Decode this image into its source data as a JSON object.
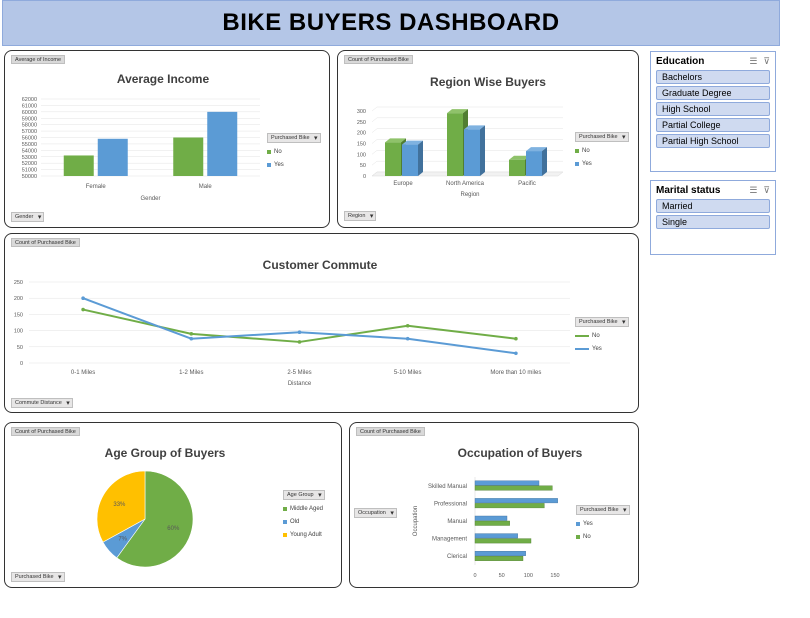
{
  "title": "BIKE BUYERS DASHBOARD",
  "colors": {
    "no": "#70ad47",
    "yes": "#5b9bd5",
    "young": "#ffc000",
    "header": "#b4c6e7"
  },
  "income": {
    "tag": "Average of Income",
    "title": "Average Income",
    "filter": "Gender",
    "legend_title": "Purchased Bike",
    "xlabel": "Gender",
    "chart_data": {
      "type": "bar",
      "categories": [
        "Female",
        "Male"
      ],
      "yticks": [
        "62000",
        "61000",
        "60000",
        "59000",
        "58000",
        "57000",
        "56000",
        "55000",
        "54000",
        "53000",
        "52000",
        "51000",
        "50000"
      ],
      "ylim": [
        50000,
        62000
      ],
      "series": [
        {
          "name": "No",
          "values": [
            53200,
            56000
          ]
        },
        {
          "name": "Yes",
          "values": [
            55800,
            60000
          ]
        }
      ]
    }
  },
  "region": {
    "tag": "Count of Purchased Bike",
    "title": "Region Wise Buyers",
    "filter": "Region",
    "legend_title": "Purchased Bike",
    "xlabel": "Region",
    "chart_data": {
      "type": "bar",
      "categories": [
        "Europe",
        "North America",
        "Pacific"
      ],
      "yticks": [
        "300",
        "250",
        "200",
        "150",
        "100",
        "50",
        "0"
      ],
      "ylim": [
        0,
        300
      ],
      "series": [
        {
          "name": "No",
          "values": [
            155,
            290,
            75
          ]
        },
        {
          "name": "Yes",
          "values": [
            145,
            215,
            115
          ]
        }
      ]
    }
  },
  "commute": {
    "tag": "Count of Purchased Bike",
    "title": "Customer Commute",
    "filter": "Commute Distance",
    "legend_title": "Purchased Bike",
    "xlabel": "Distance",
    "chart_data": {
      "type": "line",
      "categories": [
        "0-1 Miles",
        "1-2 Miles",
        "2-5 Miles",
        "5-10 Miles",
        "More than 10 miles"
      ],
      "yticks": [
        "250",
        "200",
        "150",
        "100",
        "50",
        "0"
      ],
      "ylim": [
        0,
        250
      ],
      "series": [
        {
          "name": "No",
          "values": [
            165,
            90,
            65,
            115,
            75
          ]
        },
        {
          "name": "Yes",
          "values": [
            200,
            75,
            95,
            75,
            30
          ]
        }
      ]
    }
  },
  "age": {
    "tag": "Count of Purchased Bike",
    "title": "Age Group of Buyers",
    "filter": "Purchased Bike",
    "legend_title": "Age Group",
    "chart_data": {
      "type": "pie",
      "labels": [
        "Middle Aged",
        "Old",
        "Young Adult"
      ],
      "values": [
        60,
        7,
        33
      ],
      "value_labels": [
        "60%",
        "7%",
        "33%"
      ]
    }
  },
  "occupation": {
    "tag": "Count of Purchased Bike",
    "title": "Occupation of Buyers",
    "filter": "Occupation",
    "legend_title": "Purchased Bike",
    "ylabel": "Occupation",
    "chart_data": {
      "type": "bar",
      "categories": [
        "Skilled Manual",
        "Professional",
        "Manual",
        "Management",
        "Clerical"
      ],
      "xticks": [
        "0",
        "50",
        "100",
        "150"
      ],
      "xlim": [
        0,
        150
      ],
      "series": [
        {
          "name": "Yes",
          "values": [
            120,
            155,
            60,
            80,
            95
          ]
        },
        {
          "name": "No",
          "values": [
            145,
            130,
            65,
            105,
            90
          ]
        }
      ]
    }
  },
  "slicers": {
    "education": {
      "title": "Education",
      "items": [
        "Bachelors",
        "Graduate Degree",
        "High School",
        "Partial College",
        "Partial High School"
      ]
    },
    "marital": {
      "title": "Marital status",
      "items": [
        "Married",
        "Single"
      ]
    }
  }
}
